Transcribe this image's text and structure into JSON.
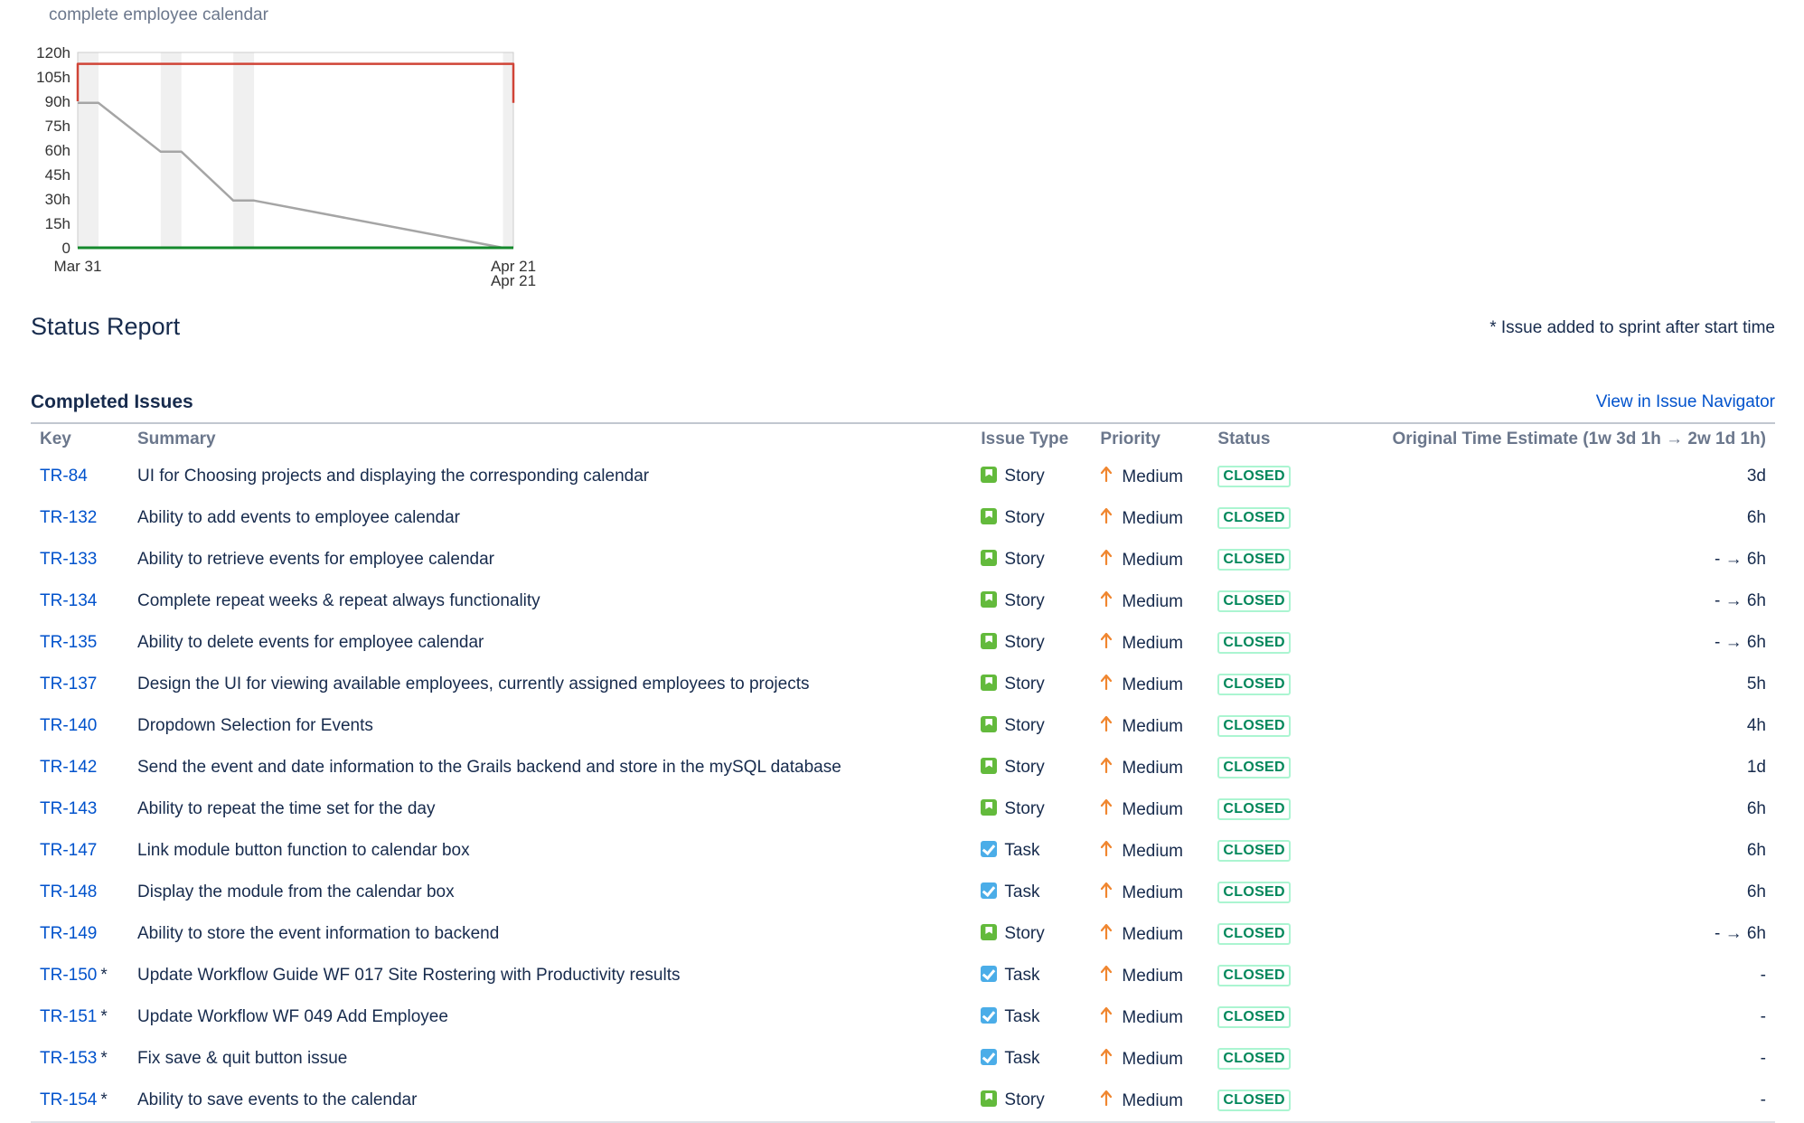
{
  "sprint_goal": "complete employee calendar",
  "chart_data": {
    "type": "line",
    "title": "",
    "xlabel": "",
    "ylabel": "",
    "y_ticks": [
      "120h",
      "105h",
      "90h",
      "75h",
      "60h",
      "45h",
      "30h",
      "15h",
      "0"
    ],
    "ylim": [
      0,
      120
    ],
    "x_labels": [
      "Mar 31",
      "Apr 21",
      "Apr 21"
    ],
    "x_range_days": [
      0,
      21
    ],
    "grid": false,
    "nonworking_bands_days": [
      [
        0,
        1
      ],
      [
        4,
        5
      ],
      [
        7.5,
        8.5
      ],
      [
        20.5,
        21
      ]
    ],
    "series": [
      {
        "color": "#d04437",
        "points": [
          [
            0,
            90
          ],
          [
            0,
            113
          ],
          [
            21,
            113
          ],
          [
            21,
            89
          ]
        ]
      },
      {
        "color": "#a5a5a5",
        "points": [
          [
            0,
            89
          ],
          [
            1,
            89
          ],
          [
            4,
            59
          ],
          [
            5,
            59
          ],
          [
            7.5,
            29
          ],
          [
            8.5,
            29
          ],
          [
            20.5,
            0
          ]
        ]
      },
      {
        "color": "#14892c",
        "points": [
          [
            0,
            0
          ],
          [
            21,
            0
          ]
        ]
      }
    ]
  },
  "status_report": {
    "title": "Status Report",
    "legend_note": "* Issue added to sprint after start time"
  },
  "completed": {
    "title": "Completed Issues",
    "navigator_link": "View in Issue Navigator",
    "columns": {
      "key": "Key",
      "summary": "Summary",
      "type": "Issue Type",
      "priority": "Priority",
      "status": "Status",
      "estimate": "Original Time Estimate (1w 3d 1h → 2w 1d 1h)"
    },
    "rows": [
      {
        "key": "TR-84",
        "mark": "",
        "summary": "UI for Choosing projects and displaying the corresponding calendar",
        "type": "Story",
        "type_icon": "story-icon",
        "priority": "Medium",
        "status": "CLOSED",
        "estimate": "3d"
      },
      {
        "key": "TR-132",
        "mark": "",
        "summary": "Ability to add events to employee calendar",
        "type": "Story",
        "type_icon": "story-icon",
        "priority": "Medium",
        "status": "CLOSED",
        "estimate": "6h"
      },
      {
        "key": "TR-133",
        "mark": "",
        "summary": "Ability to retrieve events for employee calendar",
        "type": "Story",
        "type_icon": "story-icon",
        "priority": "Medium",
        "status": "CLOSED",
        "estimate": "- → 6h"
      },
      {
        "key": "TR-134",
        "mark": "",
        "summary": "Complete repeat weeks & repeat always functionality",
        "type": "Story",
        "type_icon": "story-icon",
        "priority": "Medium",
        "status": "CLOSED",
        "estimate": "- → 6h"
      },
      {
        "key": "TR-135",
        "mark": "",
        "summary": "Ability to delete events for employee calendar",
        "type": "Story",
        "type_icon": "story-icon",
        "priority": "Medium",
        "status": "CLOSED",
        "estimate": "- → 6h"
      },
      {
        "key": "TR-137",
        "mark": "",
        "summary": "Design the UI for viewing available employees, currently assigned employees to projects",
        "type": "Story",
        "type_icon": "story-icon",
        "priority": "Medium",
        "status": "CLOSED",
        "estimate": "5h"
      },
      {
        "key": "TR-140",
        "mark": "",
        "summary": "Dropdown Selection for Events",
        "type": "Story",
        "type_icon": "story-icon",
        "priority": "Medium",
        "status": "CLOSED",
        "estimate": "4h"
      },
      {
        "key": "TR-142",
        "mark": "",
        "summary": "Send the event and date information to the Grails backend and store in the mySQL database",
        "type": "Story",
        "type_icon": "story-icon",
        "priority": "Medium",
        "status": "CLOSED",
        "estimate": "1d"
      },
      {
        "key": "TR-143",
        "mark": "",
        "summary": "Ability to repeat the time set for the day",
        "type": "Story",
        "type_icon": "story-icon",
        "priority": "Medium",
        "status": "CLOSED",
        "estimate": "6h"
      },
      {
        "key": "TR-147",
        "mark": "",
        "summary": "Link module button function to calendar box",
        "type": "Task",
        "type_icon": "task-icon",
        "priority": "Medium",
        "status": "CLOSED",
        "estimate": "6h"
      },
      {
        "key": "TR-148",
        "mark": "",
        "summary": "Display the module from the calendar box",
        "type": "Task",
        "type_icon": "task-icon",
        "priority": "Medium",
        "status": "CLOSED",
        "estimate": "6h"
      },
      {
        "key": "TR-149",
        "mark": "",
        "summary": "Ability to store the event information to backend",
        "type": "Story",
        "type_icon": "story-icon",
        "priority": "Medium",
        "status": "CLOSED",
        "estimate": "- → 6h"
      },
      {
        "key": "TR-150",
        "mark": "*",
        "summary": "Update Workflow Guide WF 017 Site Rostering with Productivity results",
        "type": "Task",
        "type_icon": "task-icon",
        "priority": "Medium",
        "status": "CLOSED",
        "estimate": "-"
      },
      {
        "key": "TR-151",
        "mark": "*",
        "summary": "Update Workflow WF 049 Add Employee",
        "type": "Task",
        "type_icon": "task-icon",
        "priority": "Medium",
        "status": "CLOSED",
        "estimate": "-"
      },
      {
        "key": "TR-153",
        "mark": "*",
        "summary": "Fix save & quit button issue",
        "type": "Task",
        "type_icon": "task-icon",
        "priority": "Medium",
        "status": "CLOSED",
        "estimate": "-"
      },
      {
        "key": "TR-154",
        "mark": "*",
        "summary": "Ability to save events to the calendar",
        "type": "Story",
        "type_icon": "story-icon",
        "priority": "Medium",
        "status": "CLOSED",
        "estimate": "-"
      }
    ]
  }
}
